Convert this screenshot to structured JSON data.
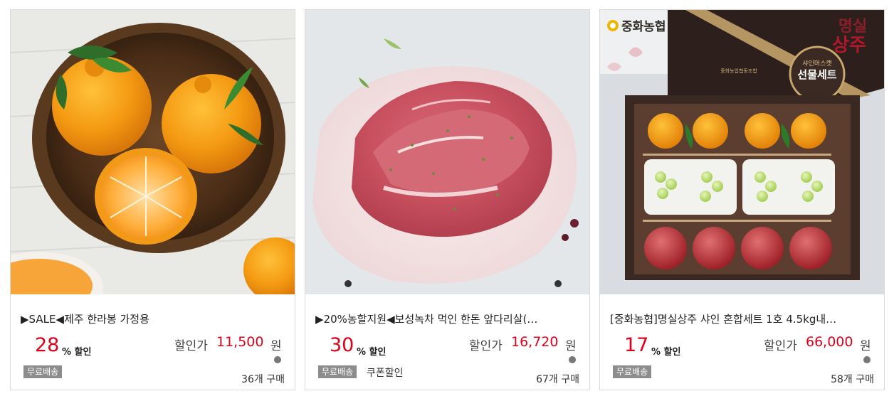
{
  "products": [
    {
      "title": "▶SALE◀제주 한라봉 가정용",
      "discount_rate": "28",
      "discount_unit": "% 할인",
      "price_label": "할인가",
      "price": "11,500",
      "price_unit": "원",
      "badge": "무료배송",
      "coupon": "",
      "purchases": "36개 구매"
    },
    {
      "title": "▶20%농할지원◀보성녹차 먹인 한돈 앞다리살(…",
      "discount_rate": "30",
      "discount_unit": "% 할인",
      "price_label": "할인가",
      "price": "16,720",
      "price_unit": "원",
      "badge": "무료배송",
      "coupon": "쿠폰할인",
      "purchases": "67개 구매"
    },
    {
      "title": "[중화농협]명실상주 샤인 혼합세트 1호 4.5kg내…",
      "discount_rate": "17",
      "discount_unit": "% 할인",
      "price_label": "할인가",
      "price": "66,000",
      "price_unit": "원",
      "badge": "무료배송",
      "coupon": "",
      "purchases": "58개 구매",
      "image_text": {
        "brand": "중화농협",
        "seal_title": "명실상주",
        "gift_label": "선물세트",
        "gift_sub": "샤인머스캣",
        "box_label": "중화농업협동조합"
      }
    }
  ]
}
